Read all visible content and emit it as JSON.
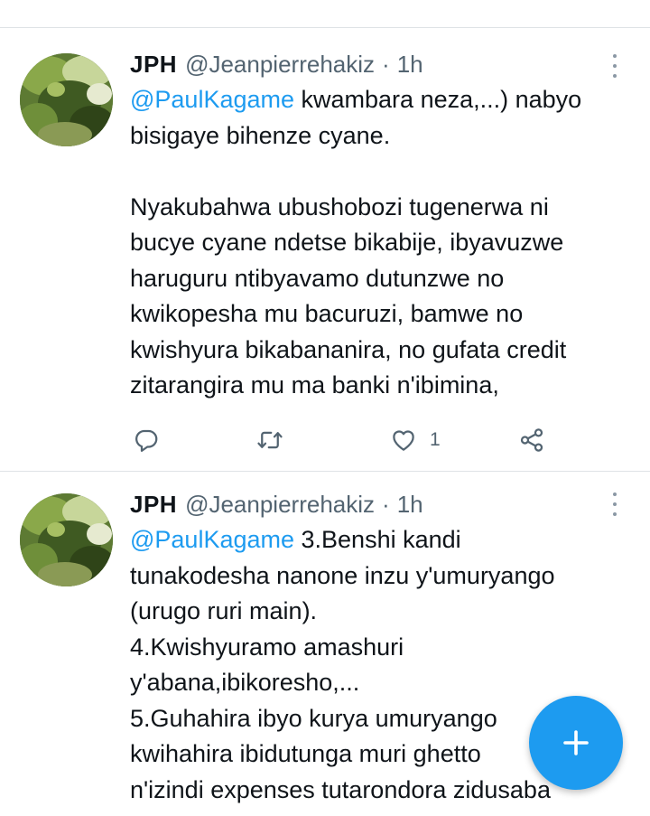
{
  "tweets": [
    {
      "name": "JPH",
      "handle": "@Jeanpierrehakiz",
      "separator": "·",
      "time": "1h",
      "mention": "@PaulKagame",
      "text": " kwambara neza,...) nabyo\nbisigaye bihenze cyane.\n\nNyakubahwa ubushobozi tugenerwa ni\nbucye cyane ndetse bikabije, ibyavuzwe\nharuguru ntibyavamo dutunzwe no\nkwikopesha mu bacuruzi, bamwe no\nkwishyura bikabananira, no gufata credit\nzitarangira mu ma banki n'ibimina,",
      "like_count": "1"
    },
    {
      "name": "JPH",
      "handle": "@Jeanpierrehakiz",
      "separator": "·",
      "time": "1h",
      "mention": "@PaulKagame",
      "text": " 3.Benshi kandi\ntunakodesha nanone inzu y'umuryango\n(urugo ruri main).\n4.Kwishyuramo amashuri\ny'abana,ibikoresho,...\n5.Guhahira ibyo kurya umuryango\nkwihahira ibidutunga muri ghetto\nn'izindi expenses tutarondora zidusaba"
    }
  ],
  "icons": {
    "reply": "reply-icon",
    "retweet": "retweet-icon",
    "like": "heart-icon",
    "share": "share-icon",
    "more": "more-vertical-icon",
    "compose": "plus-icon"
  },
  "colors": {
    "accent": "#1d9bf0",
    "text": "#0f1419",
    "secondary": "#536471",
    "divider": "#dfe3e6"
  }
}
